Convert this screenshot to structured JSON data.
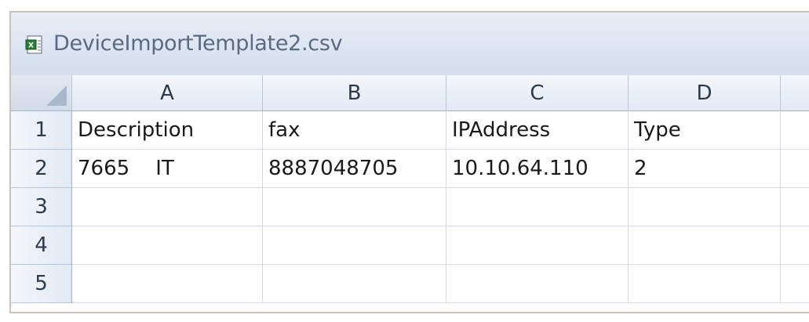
{
  "window": {
    "title": "DeviceImportTemplate2.csv",
    "icon": "excel-csv-file-icon"
  },
  "columns": [
    "A",
    "B",
    "C",
    "D",
    ""
  ],
  "row_numbers": [
    "1",
    "2",
    "3",
    "4",
    "5"
  ],
  "cells": [
    [
      "Description",
      "fax",
      "IPAddress",
      "Type",
      ""
    ],
    [
      "7665    IT",
      "8887048705",
      "10.10.64.110",
      "2",
      ""
    ],
    [
      "",
      "",
      "",
      "",
      ""
    ],
    [
      "",
      "",
      "",
      "",
      ""
    ],
    [
      "",
      "",
      "",
      "",
      ""
    ]
  ],
  "colors": {
    "header_bg": "#e2e9f3",
    "grid_line": "#d4dbe6",
    "title_text": "#5a6a80"
  }
}
